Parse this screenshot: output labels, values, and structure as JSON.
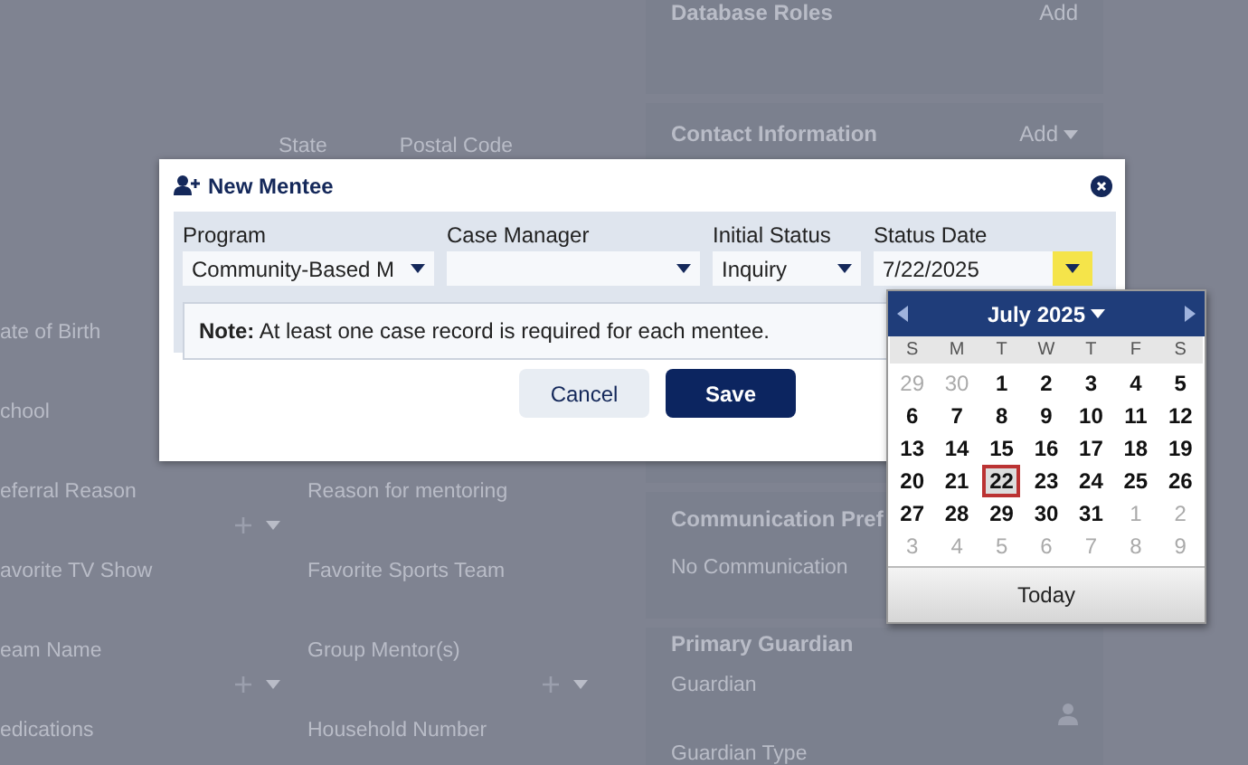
{
  "background": {
    "top_labels": [
      "State",
      "Postal Code"
    ],
    "rows": [
      {
        "left": {
          "label": "ate of Birth"
        }
      },
      {
        "left": {
          "label": "chool"
        }
      },
      {
        "left": {
          "label": "eferral Reason",
          "add": true
        },
        "right": {
          "label": "Reason for mentoring",
          "add": false
        }
      },
      {
        "left": {
          "label": "avorite TV Show",
          "add": false
        },
        "right": {
          "label": "Favorite Sports Team",
          "add": false
        }
      },
      {
        "left": {
          "label": "eam Name",
          "add": true
        },
        "right": {
          "label": "Group Mentor(s)",
          "add": true
        }
      },
      {
        "left": {
          "label": "edications",
          "add": false
        },
        "right": {
          "label": "Household Number",
          "add": false
        }
      }
    ],
    "cards": [
      {
        "title": "Database Roles",
        "action": "Add",
        "caret": false
      },
      {
        "title": "Contact Information",
        "action": "Add",
        "caret": true
      },
      {
        "title": "Communication Pref",
        "items": [
          {
            "label": "No Communication"
          }
        ]
      },
      {
        "title": "Primary Guardian",
        "items": [
          {
            "label": "Guardian",
            "person": true
          },
          {
            "label": "Guardian Type",
            "person": false
          }
        ]
      }
    ]
  },
  "dialog": {
    "title": "New Mentee",
    "fields": [
      {
        "label": "Program",
        "value": "Community-Based M",
        "kind": "select"
      },
      {
        "label": "Case Manager",
        "kind": "select"
      },
      {
        "label": "Initial Status",
        "value": "Inquiry",
        "kind": "select"
      },
      {
        "label": "Status Date",
        "value": "7/22/2025",
        "kind": "date"
      }
    ],
    "note": "**Note:** At least one case record is required for each mentee.",
    "buttons": [
      {
        "label": "Cancel",
        "kind": "secondary"
      },
      {
        "label": "Save",
        "kind": "primary"
      }
    ]
  },
  "calendar": {
    "month": "July 2025",
    "weekdays": [
      "S",
      "M",
      "T",
      "W",
      "T",
      "F",
      "S"
    ],
    "weeks": [
      [
        {
          "day": "29",
          "other": true,
          "selected": false
        },
        {
          "day": "30",
          "other": true,
          "selected": false
        },
        {
          "day": "1",
          "other": false,
          "selected": false
        },
        {
          "day": "2",
          "other": false,
          "selected": false
        },
        {
          "day": "3",
          "other": false,
          "selected": false
        },
        {
          "day": "4",
          "other": false,
          "selected": false
        },
        {
          "day": "5",
          "other": false,
          "selected": false
        }
      ],
      [
        {
          "day": "6",
          "other": false,
          "selected": false
        },
        {
          "day": "7",
          "other": false,
          "selected": false
        },
        {
          "day": "8",
          "other": false,
          "selected": false
        },
        {
          "day": "9",
          "other": false,
          "selected": false
        },
        {
          "day": "10",
          "other": false,
          "selected": false
        },
        {
          "day": "11",
          "other": false,
          "selected": false
        },
        {
          "day": "12",
          "other": false,
          "selected": false
        }
      ],
      [
        {
          "day": "13",
          "other": false,
          "selected": false
        },
        {
          "day": "14",
          "other": false,
          "selected": false
        },
        {
          "day": "15",
          "other": false,
          "selected": false
        },
        {
          "day": "16",
          "other": false,
          "selected": false
        },
        {
          "day": "17",
          "other": false,
          "selected": false
        },
        {
          "day": "18",
          "other": false,
          "selected": false
        },
        {
          "day": "19",
          "other": false,
          "selected": false
        }
      ],
      [
        {
          "day": "20",
          "other": false,
          "selected": false
        },
        {
          "day": "21",
          "other": false,
          "selected": false
        },
        {
          "day": "22",
          "other": false,
          "selected": true
        },
        {
          "day": "23",
          "other": false,
          "selected": false
        },
        {
          "day": "24",
          "other": false,
          "selected": false
        },
        {
          "day": "25",
          "other": false,
          "selected": false
        },
        {
          "day": "26",
          "other": false,
          "selected": false
        }
      ],
      [
        {
          "day": "27",
          "other": false,
          "selected": false
        },
        {
          "day": "28",
          "other": false,
          "selected": false
        },
        {
          "day": "29",
          "other": false,
          "selected": false
        },
        {
          "day": "30",
          "other": false,
          "selected": false
        },
        {
          "day": "31",
          "other": false,
          "selected": false
        },
        {
          "day": "1",
          "other": true,
          "selected": false
        },
        {
          "day": "2",
          "other": true,
          "selected": false
        }
      ],
      [
        {
          "day": "3",
          "other": true,
          "selected": false
        },
        {
          "day": "4",
          "other": true,
          "selected": false
        },
        {
          "day": "5",
          "other": true,
          "selected": false
        },
        {
          "day": "6",
          "other": true,
          "selected": false
        },
        {
          "day": "7",
          "other": true,
          "selected": false
        },
        {
          "day": "8",
          "other": true,
          "selected": false
        },
        {
          "day": "9",
          "other": true,
          "selected": false
        }
      ]
    ],
    "today": "Today"
  }
}
